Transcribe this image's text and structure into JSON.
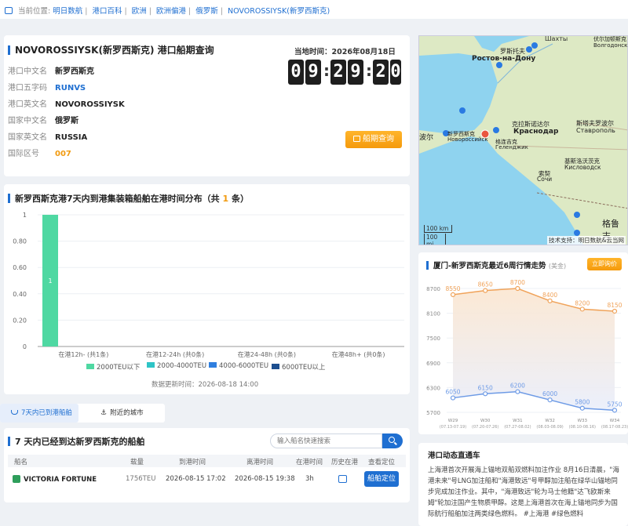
{
  "breadcrumb": {
    "prefix": "当前位置:",
    "items": [
      "明日数航",
      "港口百科",
      "欧洲",
      "欧洲偏港",
      "俄罗斯",
      "NOVOROSSIYSK(新罗西斯克)"
    ]
  },
  "port": {
    "title": "NOVOROSSIYSK(新罗西斯克) 港口船期查询",
    "local_time_label": "当地时间：2026年08月18日",
    "clock_digits": [
      "0",
      "9",
      "2",
      "9",
      "2",
      "0"
    ],
    "fields": [
      {
        "label": "港口中文名",
        "value": "新罗西斯克",
        "tone": "dark"
      },
      {
        "label": "港口五字码",
        "value": "RUNVS",
        "tone": "blue"
      },
      {
        "label": "港口英文名",
        "value": "NOVOROSSIYSK",
        "tone": "dark"
      },
      {
        "label": "国家中文名",
        "value": "俄罗斯",
        "tone": "dark"
      },
      {
        "label": "国家英文名",
        "value": "RUSSIA",
        "tone": "dark"
      },
      {
        "label": "国际区号",
        "value": "007",
        "tone": "orange"
      }
    ],
    "schedule_button": "船期查询"
  },
  "map": {
    "labels": [
      "Шахты",
      "Ростов-на-Дону",
      "罗斯托夫",
      "克拉斯诺达尔",
      "Краснодар",
      "新罗西斯克",
      "Новороссийск",
      "格连吉克",
      "Геленджик",
      "斯塔夫罗波尔",
      "Ставрополь",
      "基斯洛沃茨克",
      "Кисловодск",
      "索契",
      "Сочи",
      "格鲁吉",
      "波尔",
      "Волгодонск",
      "伏尔加顿斯克"
    ],
    "scale_km": "100 km",
    "scale_mi": "100 mi",
    "credit": "技术支持：明日数航&云当网",
    "colors": {
      "sea": "#8fd3ef",
      "land": "#dde9c4",
      "marker": "#2a7ae2",
      "marker_current": "#e9573f"
    }
  },
  "distribution": {
    "title_prefix": "新罗西斯克港7天内到港集装箱船舶在港时间分布（共",
    "count": "1",
    "title_suffix": "条）",
    "updated": "数据更新时间：2026-08-18 14:00"
  },
  "chart_data": {
    "type": "bar",
    "categories": [
      "在港12h- (共1条)",
      "在港12-24h (共0条)",
      "在港24-48h (共0条)",
      "在港48h+ (共0条)"
    ],
    "series": [
      {
        "name": "2000TEU以下",
        "values": [
          1,
          0,
          0,
          0
        ],
        "color": "#4fd8a2"
      },
      {
        "name": "2000-4000TEU",
        "values": [
          0,
          0,
          0,
          0
        ],
        "color": "#2ec4c6"
      },
      {
        "name": "4000-6000TEU",
        "values": [
          0,
          0,
          0,
          0
        ],
        "color": "#2f7fdf"
      },
      {
        "name": "6000TEU以上",
        "values": [
          0,
          0,
          0,
          0
        ],
        "color": "#1d4f8f"
      }
    ],
    "bar_label": "1",
    "ylim": [
      0,
      1
    ],
    "yticks": [
      "0",
      "0.20",
      "0.40",
      "0.60",
      "0.80",
      "1"
    ],
    "grid": true,
    "legend": "bottom"
  },
  "tabs": [
    {
      "label": "7天内已到港船舶",
      "icon": "ship-icon",
      "active": true
    },
    {
      "label": "附近的城市",
      "icon": "anchor-icon",
      "active": false
    }
  ],
  "ships": {
    "title": "7 天内已经到达新罗西斯克的船舶",
    "search_placeholder": "输入船名快速搜索",
    "headers": [
      "船名",
      "载量",
      "到港时间",
      "离港时间",
      "在港时间",
      "历史在港",
      "查看定位"
    ],
    "rows": [
      {
        "name": "VICTORIA FORTUNE",
        "capacity": "1756TEU",
        "arrival": "2026-08-15 17:02",
        "departure": "2026-08-15 19:38",
        "duration": "3h",
        "locate": "船舶定位"
      }
    ]
  },
  "freight": {
    "title": "厦门-新罗西斯克最近6周行情走势",
    "unit": "(美金)",
    "ask_button": "立即询价",
    "yticks": [
      "8700",
      "8100",
      "7500",
      "6900",
      "6300",
      "5700"
    ],
    "weeks": [
      {
        "w": "W29",
        "range": "(07.13-07.19)"
      },
      {
        "w": "W30",
        "range": "(07.20-07.26)"
      },
      {
        "w": "W31",
        "range": "(07.27-08.02)"
      },
      {
        "w": "W32",
        "range": "(08.03-08.09)"
      },
      {
        "w": "W33",
        "range": "(08.10-08.16)"
      },
      {
        "w": "W34",
        "range": "(08.17-08.23)"
      }
    ],
    "upper": [
      8550,
      8650,
      8700,
      8400,
      8200,
      8150
    ],
    "lower": [
      6050,
      6150,
      6200,
      6000,
      5800,
      5750
    ],
    "upper_labels": [
      "8550",
      "8650",
      "8700",
      "8400",
      "8200",
      "8150"
    ],
    "lower_labels": [
      "6050",
      "6150",
      "6200",
      "6000",
      "5800",
      "5750"
    ],
    "colors": {
      "upper": "#f0a35a",
      "lower": "#6e9be6"
    }
  },
  "news": {
    "title": "港口动态直通车",
    "text": "上海港首次开展海上锚地双船双燃料加注作业 8月16日清晨，\"海港未来\"号LNG加注船和\"海港致远\"号甲醇加注船在绿华山锚地同步完成加注作业。其中，\"海港致远\"轮为马士他籍\"达飞欧斯来姆\"轮加注国产生物质甲醇。这是上海港首次在海上锚地同步为国际航行船舶加注两类绿色燃料。 #上海港 #绿色燃料"
  }
}
